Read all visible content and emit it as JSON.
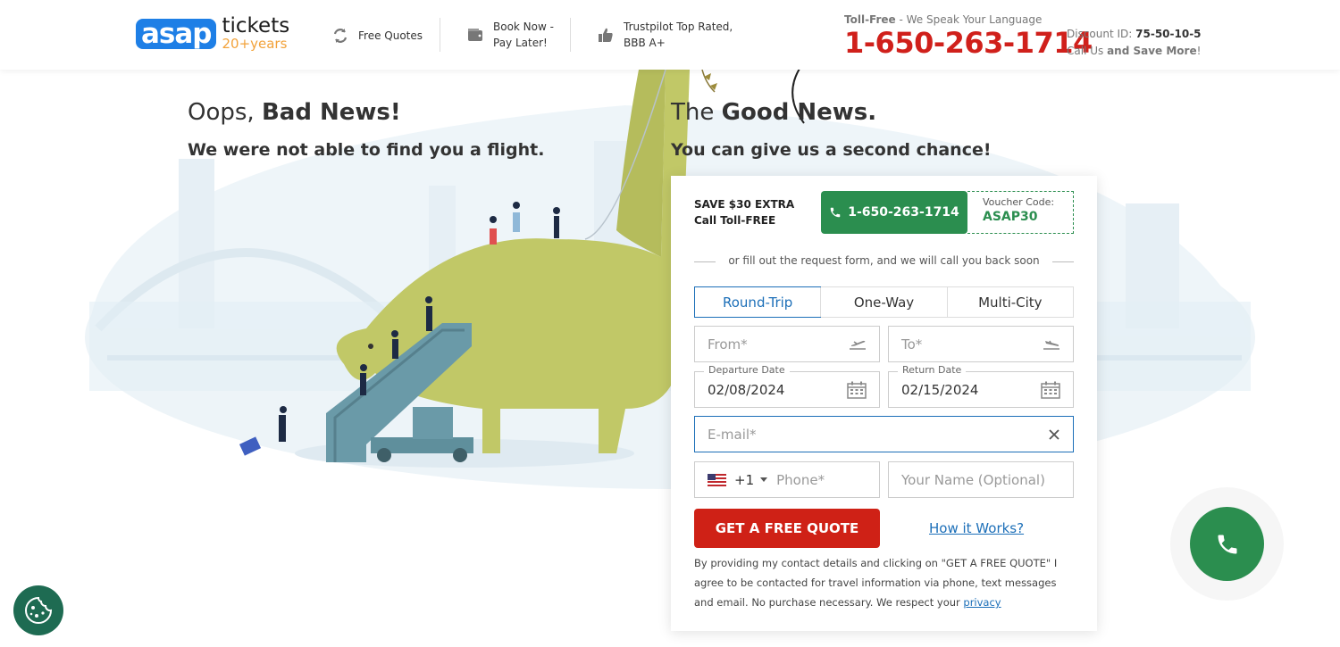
{
  "header": {
    "logo_main": "asap",
    "logo_sub": "tickets",
    "logo_years": "20+years",
    "features": [
      {
        "label": "Free Quotes",
        "icon": "refresh-icon"
      },
      {
        "label": "Book Now -",
        "label2": "Pay Later!",
        "icon": "wallet-icon"
      },
      {
        "label": "Trustpilot Top Rated,",
        "label2": "BBB A+",
        "icon": "thumbs-up-icon"
      }
    ],
    "tollfree_label": "Toll-Free",
    "tollfree_text": " - We Speak Your Language",
    "phone": "1-650-263-1714",
    "discount_label": "Discount ID: ",
    "discount_id": "75-50-10-5",
    "call_us": "Call Us ",
    "save_more": "and Save More",
    "exclaim": "!"
  },
  "left": {
    "title_plain": "Oops, ",
    "title_bold": "Bad News!",
    "subtitle": "We were not able to find you a flight."
  },
  "right": {
    "title_plain": "The ",
    "title_bold": "Good News.",
    "subtitle": "You can give us a second chance!"
  },
  "form": {
    "save_line1": "SAVE $30 EXTRA",
    "save_line2": "Call Toll-FREE",
    "call_button": "1-650-263-1714",
    "voucher_label": "Voucher Code:",
    "voucher_code": "ASAP30",
    "or_fill": "or fill out the request form, and we will call you back soon",
    "tabs": [
      "Round-Trip",
      "One-Way",
      "Multi-City"
    ],
    "active_tab": "Round-Trip",
    "from_placeholder": "From*",
    "to_placeholder": "To*",
    "departure_label": "Departure Date",
    "departure_value": "02/08/2024",
    "return_label": "Return Date",
    "return_value": "02/15/2024",
    "email_placeholder": "E-mail*",
    "phone_code": "+1",
    "phone_placeholder": "Phone*",
    "name_placeholder": "Your Name (Optional)",
    "quote_button": "GET A FREE QUOTE",
    "how_it_works": "How it Works?",
    "legal_text": "By providing my contact details and clicking on \"GET A FREE QUOTE\" I agree to be contacted for travel information via phone, text messages and email. No purchase necessary. We respect your ",
    "privacy_link": "privacy"
  },
  "colors": {
    "brand_blue": "#1e7fe6",
    "phone_red": "#d0201b",
    "green": "#2b8e4f",
    "quote_red": "#cf2116",
    "link_blue": "#1c6fb8"
  }
}
